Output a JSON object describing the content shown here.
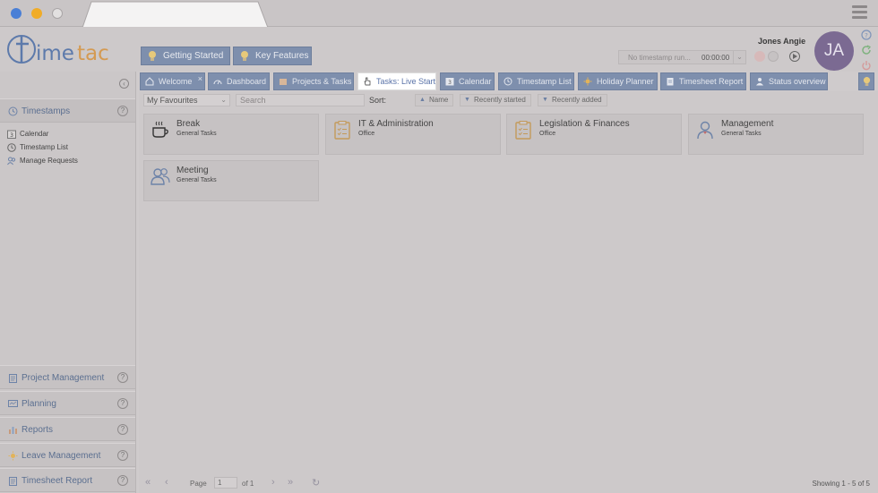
{
  "app": {
    "logo_text": "timetac"
  },
  "header": {
    "getting_started": "Getting Started",
    "key_features": "Key Features",
    "user_name": "Jones Angie",
    "avatar_initials": "JA",
    "timestamp_runner": "No timestamp run...",
    "timestamp_time": "00:00:00"
  },
  "sidebar": {
    "timestamps": {
      "label": "Timestamps",
      "items": [
        {
          "label": "Calendar",
          "icon": "calendar-icon"
        },
        {
          "label": "Timestamp List",
          "icon": "clock-icon"
        },
        {
          "label": "Manage Requests",
          "icon": "users-icon"
        }
      ]
    },
    "sections": [
      {
        "label": "Project Management",
        "icon": "clipboard-icon"
      },
      {
        "label": "Planning",
        "icon": "planning-icon"
      },
      {
        "label": "Reports",
        "icon": "bar-chart-icon"
      },
      {
        "label": "Leave Management",
        "icon": "sun-icon"
      },
      {
        "label": "Timesheet Report",
        "icon": "clipboard-icon"
      }
    ]
  },
  "tabs": [
    {
      "label": "Welcome",
      "icon": "home-icon"
    },
    {
      "label": "Dashboard",
      "icon": "gauge-icon"
    },
    {
      "label": "Projects & Tasks",
      "icon": "folder-icon"
    },
    {
      "label": "Tasks: Live Start",
      "icon": "hand-pointer-icon",
      "active": true
    },
    {
      "label": "Calendar",
      "icon": "calendar-icon"
    },
    {
      "label": "Timestamp List",
      "icon": "clock-icon"
    },
    {
      "label": "Holiday Planner",
      "icon": "sun-icon"
    },
    {
      "label": "Timesheet Report",
      "icon": "clipboard-icon"
    },
    {
      "label": "Status overview",
      "icon": "person-icon"
    }
  ],
  "toolbar": {
    "filter_value": "My Favourites",
    "search_placeholder": "Search",
    "sort_label": "Sort:",
    "sort_name": "Name",
    "sort_recent_started": "Recently started",
    "sort_recent_added": "Recently added"
  },
  "cards": [
    {
      "title": "Break",
      "subtitle": "General Tasks",
      "icon": "coffee-cup-icon"
    },
    {
      "title": "IT & Administration",
      "subtitle": "Office",
      "icon": "clipboard-list-icon"
    },
    {
      "title": "Legislation & Finances",
      "subtitle": "Office",
      "icon": "clipboard-list-icon"
    },
    {
      "title": "Management",
      "subtitle": "General Tasks",
      "icon": "manager-icon"
    },
    {
      "title": "Meeting",
      "subtitle": "General Tasks",
      "icon": "meeting-icon"
    }
  ],
  "pager": {
    "page_label": "Page",
    "page_value": "1",
    "of_label": "of 1",
    "showing": "Showing 1 - 5 of 5"
  },
  "colors": {
    "accent": "#7e8fad",
    "active_tab_text": "#5a73a8",
    "avatar": "#7b6a92"
  }
}
